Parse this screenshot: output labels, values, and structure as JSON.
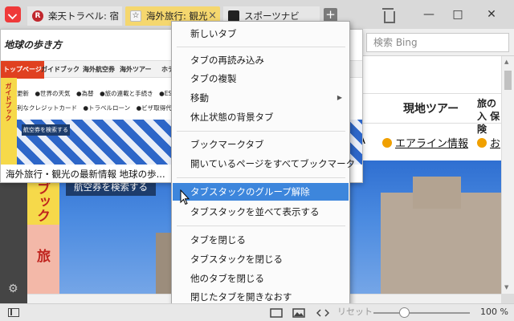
{
  "tabs": [
    {
      "label": "楽天トラベル: 宿",
      "favicon": "R"
    },
    {
      "label": "海外旅行: 観光",
      "favicon": "☆"
    },
    {
      "label": "スポーツナビ",
      "favicon": ""
    }
  ],
  "tab_close": "×",
  "new_tab": "+",
  "window": {
    "minimize": "—",
    "maximize": "□",
    "close": "✕"
  },
  "search": {
    "placeholder": "検索 Bing"
  },
  "page": {
    "nav": [
      "ル",
      "現地ツアー",
      "旅の入 保険"
    ],
    "links": [
      "A",
      "エアライン情報",
      "お"
    ],
    "strip_top": "ブック",
    "strip_bottom": "旅",
    "search_flight_button": "航空券を検索する"
  },
  "preview": {
    "logo": "地球の歩き方",
    "nav": [
      "トップページ",
      "ガイドブック",
      "海外航空券",
      "海外ツアー",
      "ホテ"
    ],
    "links1": [
      "更新",
      "世界の天気",
      "為替",
      "旅の連載と手続き",
      "ES"
    ],
    "links2": [
      "利なクレジットカード",
      "トラベルローン",
      "ビザ取得代"
    ],
    "side": "ガイドブック",
    "button": "航空券を検索する",
    "caption": "海外旅行・観光の最新情報 地球の歩...",
    "close": "×"
  },
  "menu": {
    "items": [
      {
        "label": "新しいタブ"
      },
      {
        "label": "タブの再読み込み"
      },
      {
        "label": "タブの複製"
      },
      {
        "label": "移動",
        "submenu": true
      },
      {
        "label": "休止状態の背景タブ"
      },
      {
        "label": "ブックマークタブ"
      },
      {
        "label": "開いているページをすべてブックマーク"
      },
      {
        "label": "タブスタックのグループ解除",
        "highlighted": true
      },
      {
        "label": "タブスタックを並べて表示する"
      },
      {
        "label": "タブを閉じる"
      },
      {
        "label": "タブスタックを閉じる"
      },
      {
        "label": "他のタブを閉じる"
      },
      {
        "label": "閉じたタブを開きなおす"
      }
    ],
    "submenu_arrow": "▶"
  },
  "statusbar": {
    "reset": "リセット",
    "zoom": "100 %"
  }
}
